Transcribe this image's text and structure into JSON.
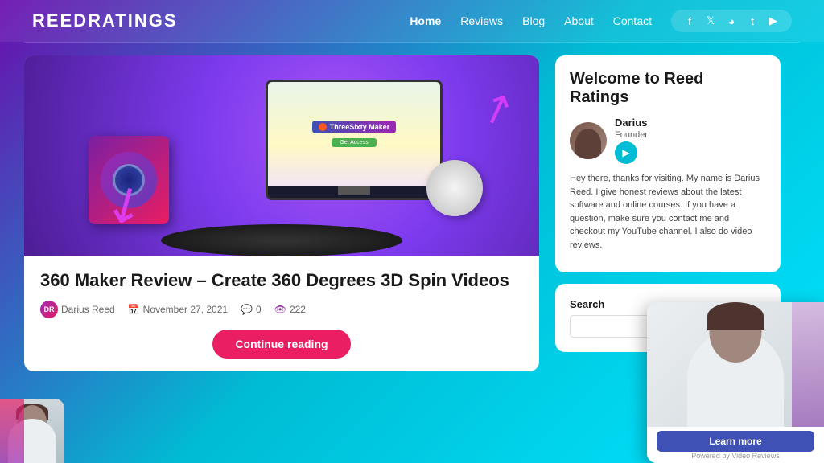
{
  "header": {
    "logo": "ReedRatings",
    "nav": {
      "items": [
        {
          "label": "Home",
          "active": true
        },
        {
          "label": "Reviews",
          "active": false
        },
        {
          "label": "Blog",
          "active": false
        },
        {
          "label": "About",
          "active": false
        },
        {
          "label": "Contact",
          "active": false
        }
      ]
    },
    "social": {
      "icons": [
        "f",
        "t",
        "p",
        "t",
        "y"
      ]
    }
  },
  "article": {
    "title": "360 Maker Review – Create 360 Degrees 3D Spin Videos",
    "image_alt": "360 Maker product image with monitor and camera",
    "meta": {
      "author": "Darius Reed",
      "date": "November 27, 2021",
      "comments": "0",
      "views": "222"
    },
    "continue_btn": "Continue reading"
  },
  "sidebar": {
    "welcome_title": "Welcome to Reed Ratings",
    "founder": {
      "name": "Darius",
      "role": "Founder"
    },
    "bio_text": "Hey there, thanks for visiting. My name is Darius Reed. I give honest reviews about the latest software and online courses. If you have a question, make sure you contact me and checkout my YouTube channel. I also do video reviews.",
    "search_label": "Search",
    "search_placeholder": ""
  },
  "video_popup": {
    "learn_more_btn": "Learn more",
    "powered_by": "Powered by Video Reviews"
  }
}
